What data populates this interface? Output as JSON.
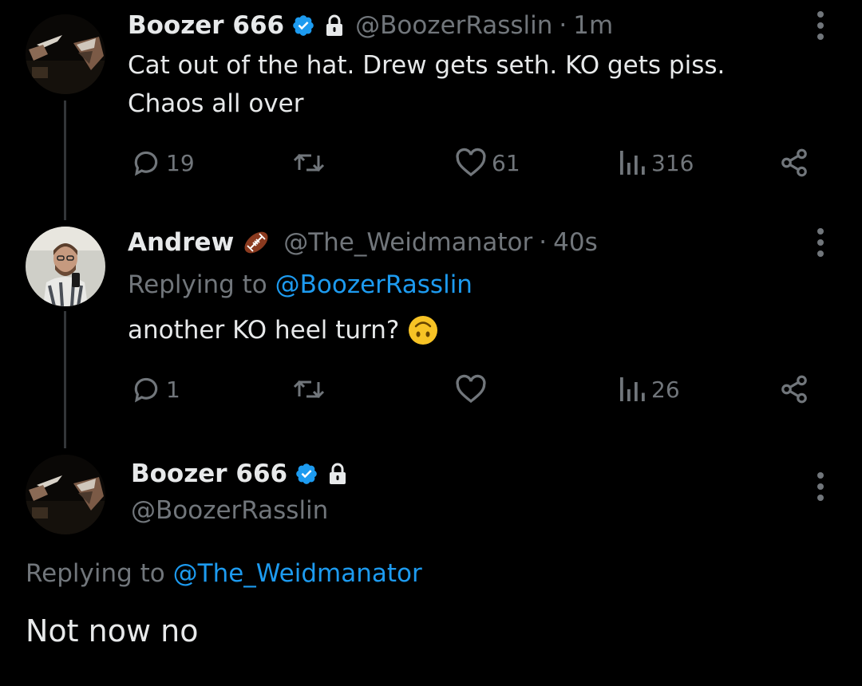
{
  "colors": {
    "background": "#000000",
    "text_primary": "#e7e9ea",
    "text_secondary": "#71767b",
    "link": "#1d9bf0",
    "verified": "#1d9bf0",
    "thread_line": "#333639"
  },
  "tweet1": {
    "display_name": "Boozer 666",
    "verified_icon": "verified-badge-icon",
    "lock_icon": "lock-icon",
    "handle": "@BoozerRasslin",
    "separator": "·",
    "time": "1m",
    "text_line1": "Cat out of the hat. Drew gets seth. KO gets piss.",
    "text_line2": "Chaos all over",
    "reply_count": "19",
    "retweet_count": "",
    "like_count": "61",
    "view_count": "316"
  },
  "tweet2": {
    "display_name": "Andrew",
    "name_emoji_icon": "football-icon",
    "handle": "@The_Weidmanator",
    "separator": "·",
    "time": "40s",
    "replying_prefix": "Replying to",
    "replying_to": "@BoozerRasslin",
    "text": "another KO heel turn?",
    "text_emoji_icon": "upside-down-face-icon",
    "reply_count": "1",
    "retweet_count": "",
    "like_count": "",
    "view_count": "26"
  },
  "tweet3": {
    "display_name": "Boozer 666",
    "verified_icon": "verified-badge-icon",
    "lock_icon": "lock-icon",
    "handle": "@BoozerRasslin",
    "replying_prefix": "Replying to",
    "replying_to": "@The_Weidmanator",
    "text": "Not now no"
  }
}
